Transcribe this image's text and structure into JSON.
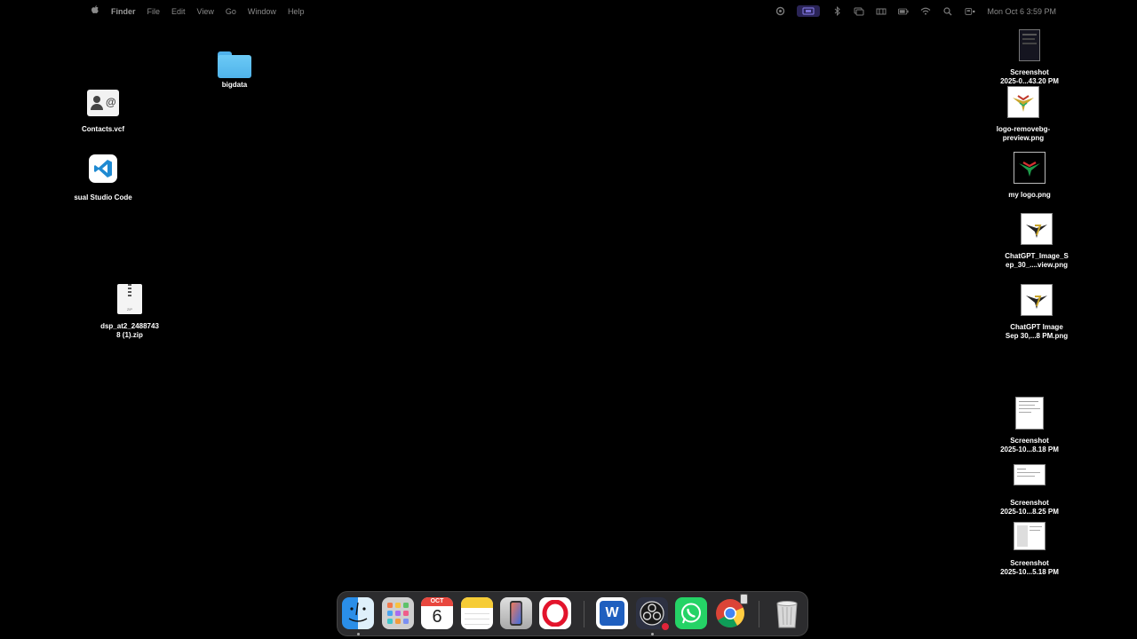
{
  "menubar": {
    "apple_glyph": "",
    "app_name": "Finder",
    "menus": [
      "File",
      "Edit",
      "View",
      "Go",
      "Window",
      "Help"
    ],
    "clock": "Mon Oct 6  3:59 PM"
  },
  "desktop": {
    "left_items": [
      {
        "label": "bigdata",
        "icon": "folder-icon"
      },
      {
        "label": "Contacts.vcf",
        "icon": "contact-card-icon"
      },
      {
        "label": "sual Studio Code",
        "icon": "vscode-icon"
      },
      {
        "label": "dsp_at2_2488743\n8 (1).zip",
        "icon": "zip-file-icon"
      }
    ],
    "right_items": [
      {
        "label": "Screenshot\n2025-0...43.20 PM",
        "icon": "screenshot-thumbnail"
      },
      {
        "label": "logo-removebg-\npreview.png",
        "icon": "image-thumbnail"
      },
      {
        "label": "my logo.png",
        "icon": "image-thumbnail"
      },
      {
        "label": "ChatGPT_Image_S\nep_30_....view.png",
        "icon": "image-thumbnail"
      },
      {
        "label": "ChatGPT Image\nSep 30,...8 PM.png",
        "icon": "image-thumbnail"
      },
      {
        "label": "Screenshot\n2025-10...8.18 PM",
        "icon": "screenshot-thumbnail"
      },
      {
        "label": "Screenshot\n2025-10...8.25 PM",
        "icon": "screenshot-thumbnail"
      },
      {
        "label": "Screenshot\n2025-10...5.18 PM",
        "icon": "screenshot-thumbnail"
      }
    ]
  },
  "dock": {
    "calendar_month": "OCT",
    "calendar_day": "6",
    "apps": [
      "Finder",
      "Launchpad",
      "Calendar",
      "Notes",
      "iPhone Mirroring",
      "Opera",
      "Microsoft Word",
      "OBS Studio",
      "WhatsApp",
      "Google Chrome",
      "Trash"
    ],
    "word_letter": "W"
  }
}
